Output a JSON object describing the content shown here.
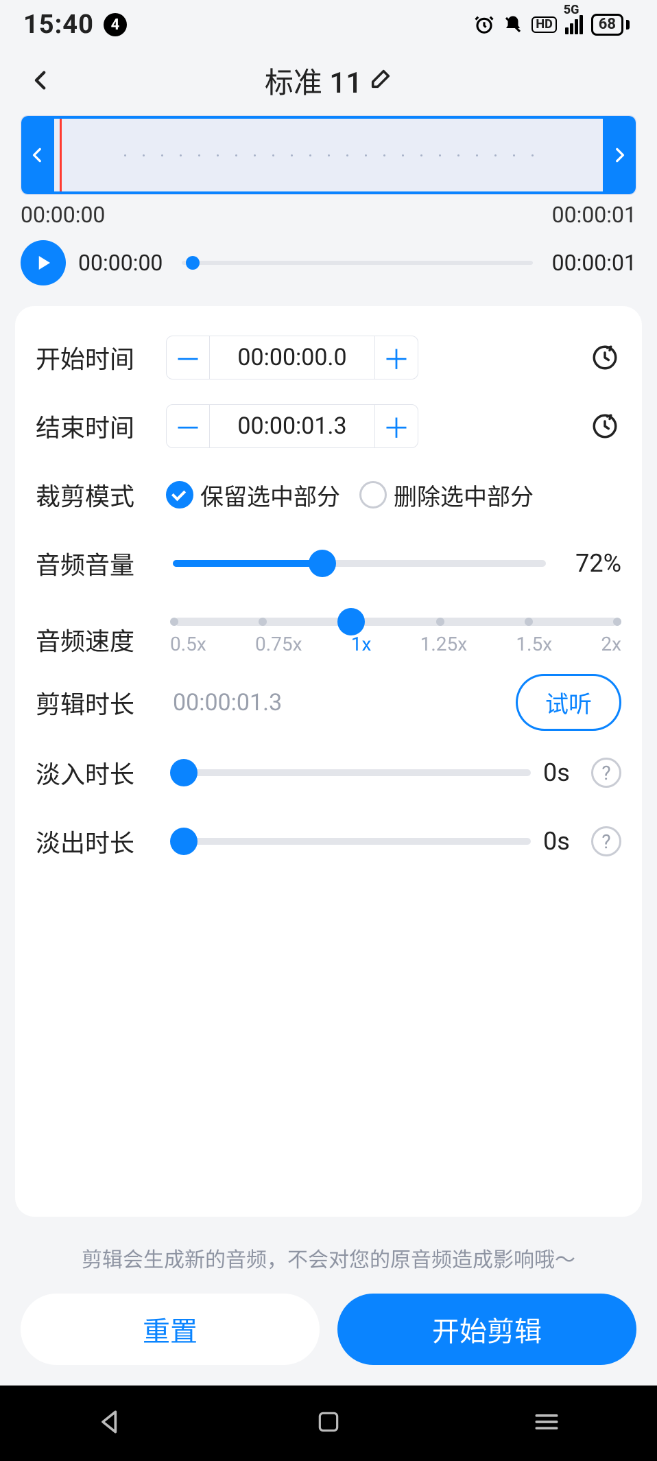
{
  "status": {
    "time": "15:40",
    "notif_badge": "4",
    "net_label": "5G",
    "hd_label": "HD",
    "battery": "68"
  },
  "header": {
    "title": "标准 11"
  },
  "wave": {
    "start_label": "00:00:00",
    "end_label": "00:00:01"
  },
  "player": {
    "current": "00:00:00",
    "total": "00:00:01"
  },
  "editor": {
    "start_time": {
      "label": "开始时间",
      "minus": "－",
      "value": "00:00:00.0",
      "plus": "＋"
    },
    "end_time": {
      "label": "结束时间",
      "minus": "－",
      "value": "00:00:01.3",
      "plus": "＋"
    },
    "crop_mode": {
      "label": "裁剪模式",
      "keep": "保留选中部分",
      "remove": "删除选中部分",
      "selected": "keep"
    },
    "volume": {
      "label": "音频音量",
      "value_text": "72%",
      "percent": 40
    },
    "speed": {
      "label": "音频速度",
      "options": [
        "0.5x",
        "0.75x",
        "1x",
        "1.25x",
        "1.5x",
        "2x"
      ],
      "selected_index": 2
    },
    "edit_dur": {
      "label": "剪辑时长",
      "value": "00:00:01.3",
      "preview": "试听"
    },
    "fade_in": {
      "label": "淡入时长",
      "value": "0s"
    },
    "fade_out": {
      "label": "淡出时长",
      "value": "0s"
    },
    "help": "?"
  },
  "footer": {
    "hint": "剪辑会生成新的音频，不会对您的原音频造成影响哦～",
    "reset": "重置",
    "start": "开始剪辑"
  }
}
